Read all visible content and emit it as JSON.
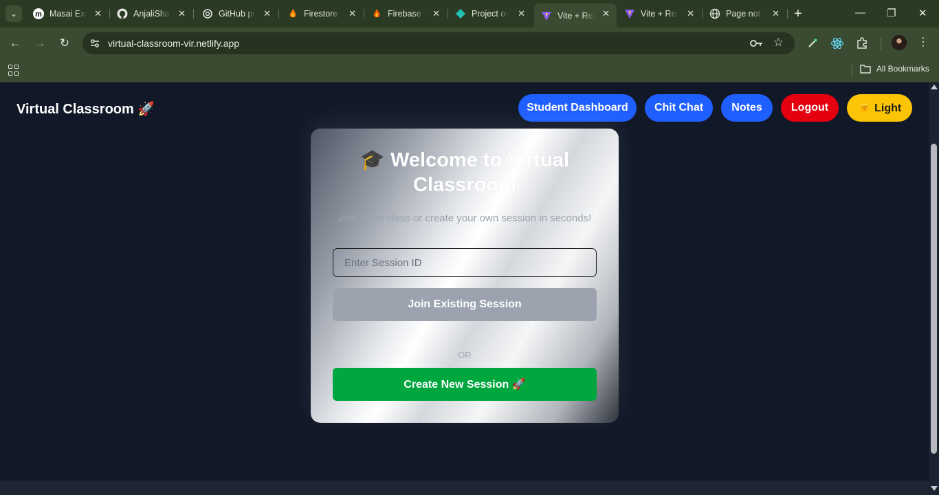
{
  "browser": {
    "tabs": [
      {
        "title": "Masai Exp",
        "icon": "masai-icon"
      },
      {
        "title": "AnjaliShar",
        "icon": "github-icon"
      },
      {
        "title": "GitHub pr",
        "icon": "openai-icon"
      },
      {
        "title": "Firestore",
        "icon": "firebase-icon"
      },
      {
        "title": "Firebase c",
        "icon": "firebase-icon"
      },
      {
        "title": "Project ov",
        "icon": "diamond-icon"
      },
      {
        "title": "Vite + Rea",
        "icon": "vite-icon",
        "active": true
      },
      {
        "title": "Vite + Rea",
        "icon": "vite-icon"
      },
      {
        "title": "Page not f",
        "icon": "globe-icon"
      }
    ],
    "tab_close_glyph": "✕",
    "new_tab_glyph": "+",
    "url": "virtual-classroom-vir.netlify.app",
    "bookmarks_label": "All Bookmarks",
    "colors": {
      "frame": "#2b3a23",
      "toolbar": "#3b4b31"
    }
  },
  "app": {
    "brand": "Virtual Classroom 🚀",
    "nav": {
      "dashboard": "Student Dashboard",
      "chat": "Chit Chat",
      "notes": "Notes",
      "logout": "Logout",
      "theme": "🌞 Light"
    },
    "card": {
      "title": "🎓 Welcome to Virtual Classroom",
      "subtitle": "Join a live class or create your own session in seconds!",
      "input_placeholder": "Enter Session ID",
      "join_label": "Join Existing Session",
      "or_label": "OR",
      "create_label": "Create New Session 🚀"
    },
    "colors": {
      "background": "#111827",
      "nav_blue": "#1f5fff",
      "logout_red": "#e5000f",
      "theme_yellow": "#fbc404",
      "join_gray": "#9ca3af",
      "create_green": "#00a63e"
    }
  }
}
